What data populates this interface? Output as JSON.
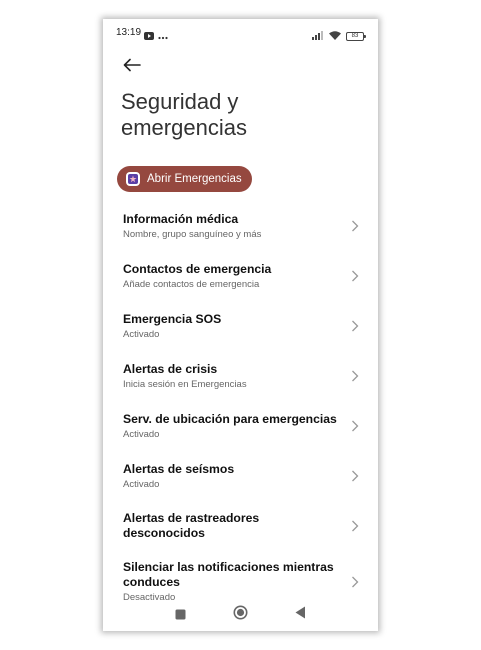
{
  "status_bar": {
    "time": "13:19",
    "battery": "83",
    "icons": [
      "youtube-icon",
      "more-dots-icon",
      "signal-icon",
      "wifi-icon",
      "battery-icon"
    ]
  },
  "header": {
    "title": "Seguridad y emergencias"
  },
  "emergency_button": {
    "label": "Abrir Emergencias",
    "color": "#95483f"
  },
  "items": [
    {
      "title": "Información médica",
      "subtitle": "Nombre, grupo sanguíneo y más"
    },
    {
      "title": "Contactos de emergencia",
      "subtitle": "Añade contactos de emergencia"
    },
    {
      "title": "Emergencia SOS",
      "subtitle": "Activado"
    },
    {
      "title": "Alertas de crisis",
      "subtitle": "Inicia sesión en Emergencias"
    },
    {
      "title": "Serv. de ubicación para emergencias",
      "subtitle": "Activado"
    },
    {
      "title": "Alertas de seísmos",
      "subtitle": "Activado"
    },
    {
      "title": "Alertas de rastreadores desconocidos",
      "subtitle": ""
    },
    {
      "title": "Silenciar las notificaciones mientras conduces",
      "subtitle": "Desactivado"
    }
  ],
  "nav_bar": {
    "icons": [
      "recents-square-icon",
      "home-circle-icon",
      "back-triangle-icon"
    ]
  }
}
